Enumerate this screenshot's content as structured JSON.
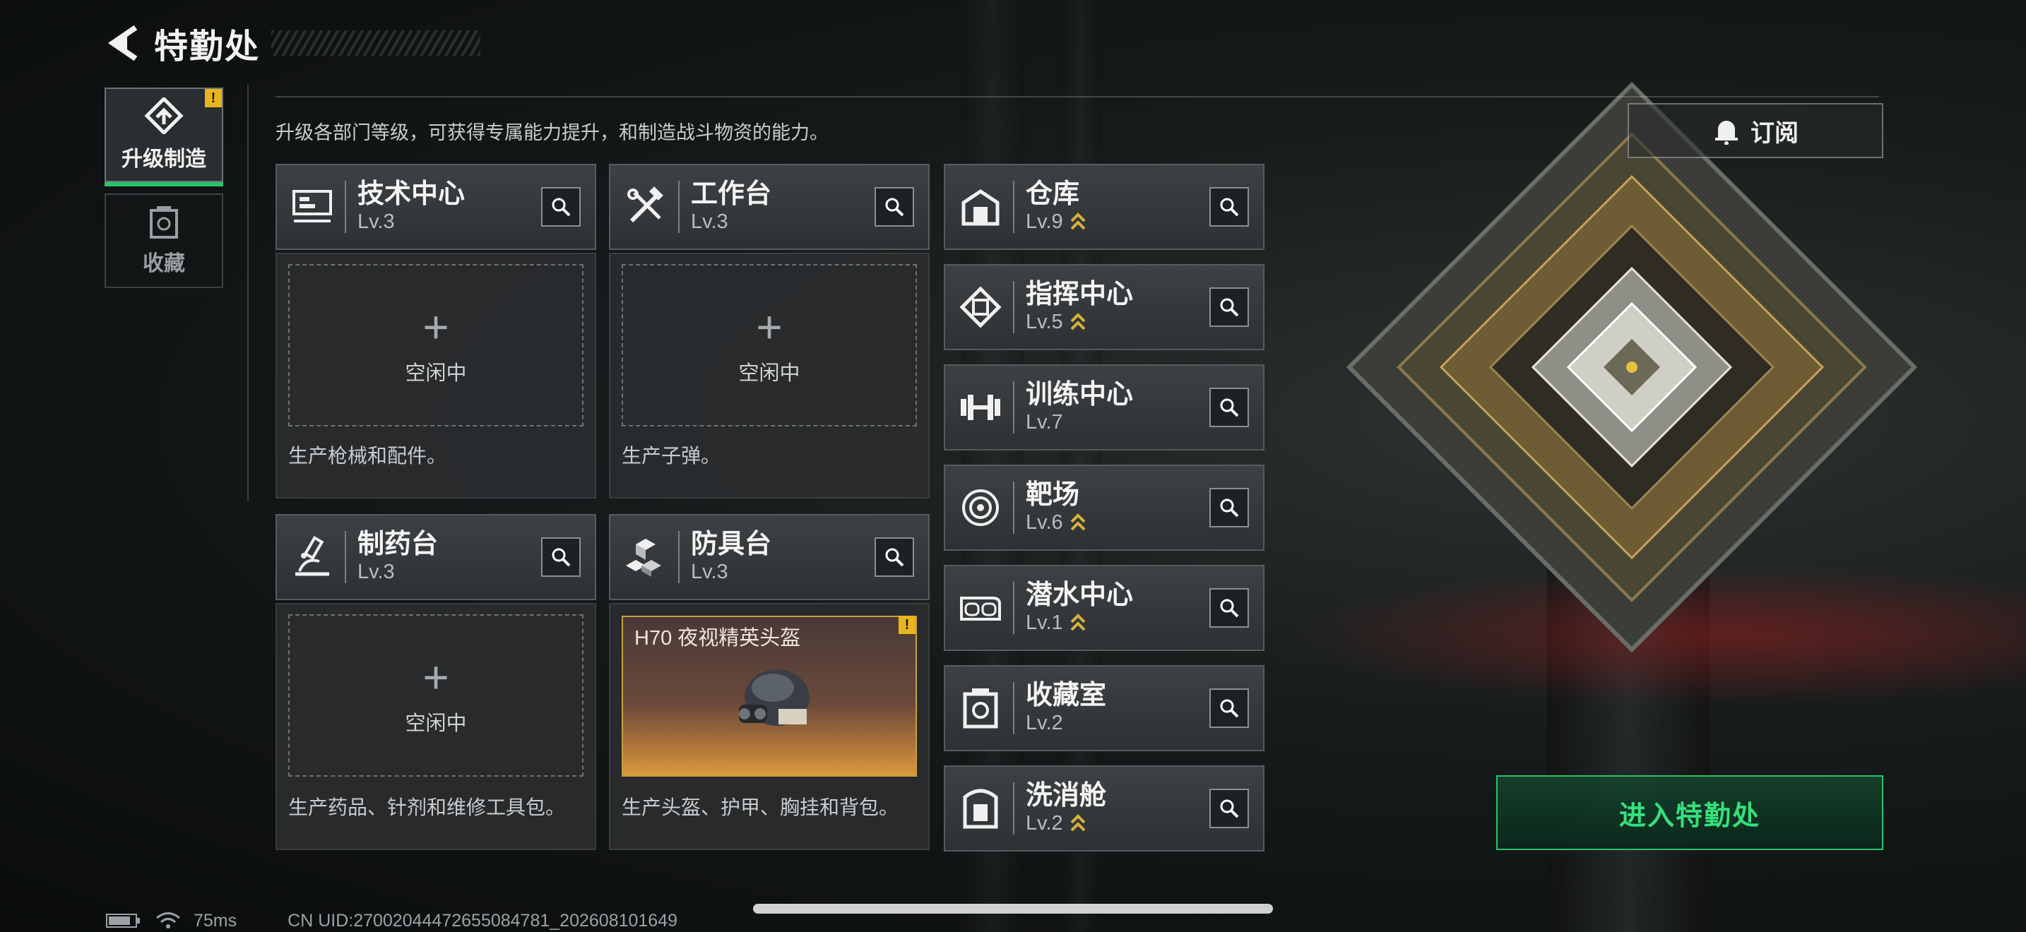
{
  "header": {
    "title": "特勤处",
    "back_icon": "back-arrow-icon"
  },
  "sidenav": {
    "items": [
      {
        "label": "升级制造",
        "icon": "upgrade-icon",
        "active": true,
        "badge": "!"
      },
      {
        "label": "收藏",
        "icon": "collection-icon",
        "active": false
      }
    ]
  },
  "main": {
    "description": "升级各部门等级，可获得专属能力提升，和制造战斗物资的能力。",
    "subscribe_label": "订阅",
    "enter_label": "进入特勤处",
    "idle_label": "空闲中"
  },
  "production": [
    {
      "name": "技术中心",
      "level": "Lv.3",
      "icon": "tech-center-icon",
      "status": "空闲中",
      "desc": "生产枪械和配件。"
    },
    {
      "name": "工作台",
      "level": "Lv.3",
      "icon": "workbench-icon",
      "status": "空闲中",
      "desc": "生产子弹。"
    },
    {
      "name": "制药台",
      "level": "Lv.3",
      "icon": "pharmacy-icon",
      "status": "空闲中",
      "desc": "生产药品、针剂和维修工具包。"
    },
    {
      "name": "防具台",
      "level": "Lv.3",
      "icon": "armor-bench-icon",
      "item": "H70 夜视精英头盔",
      "badge": "!",
      "desc": "生产头盔、护甲、胸挂和背包。"
    }
  ],
  "facilities": [
    {
      "name": "仓库",
      "level": "Lv.9",
      "icon": "warehouse-icon",
      "upgradable": true
    },
    {
      "name": "指挥中心",
      "level": "Lv.5",
      "icon": "command-center-icon",
      "upgradable": true
    },
    {
      "name": "训练中心",
      "level": "Lv.7",
      "icon": "training-center-icon",
      "upgradable": false
    },
    {
      "name": "靶场",
      "level": "Lv.6",
      "icon": "shooting-range-icon",
      "upgradable": true
    },
    {
      "name": "潜水中心",
      "level": "Lv.1",
      "icon": "diving-center-icon",
      "upgradable": true
    },
    {
      "name": "收藏室",
      "level": "Lv.2",
      "icon": "collection-room-icon",
      "upgradable": false
    },
    {
      "name": "洗消舱",
      "level": "Lv.2",
      "icon": "decontamination-icon",
      "upgradable": true
    }
  ],
  "status": {
    "ping": "75ms",
    "uid": "CN UID:270020444726550847​81_202608101649"
  },
  "colors": {
    "accent_green": "#27c46a",
    "warning_yellow": "#e8b520",
    "upgrade_gold": "#d8b040"
  }
}
